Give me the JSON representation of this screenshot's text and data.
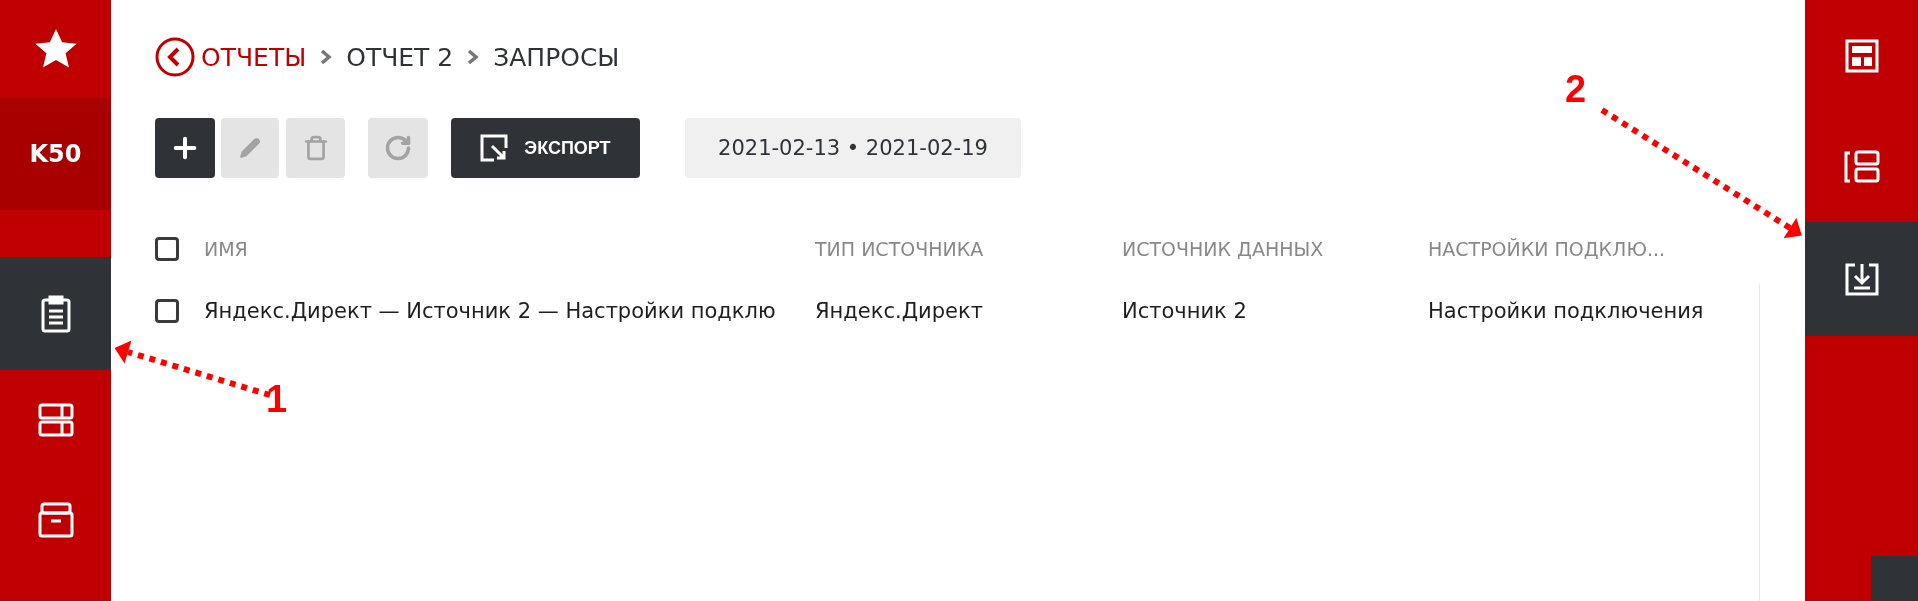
{
  "left_sidebar": {
    "items": [
      {
        "kind": "star",
        "selected": false
      },
      {
        "kind": "text",
        "label": "K50",
        "selected": false
      },
      {
        "kind": "clipboard",
        "selected": true
      },
      {
        "kind": "rows",
        "selected": false
      },
      {
        "kind": "archive",
        "selected": false
      }
    ]
  },
  "breadcrumb": {
    "items": [
      "ОТЧЕТЫ",
      "ОТЧЕТ 2",
      "ЗАПРОСЫ"
    ]
  },
  "toolbar": {
    "buttons": [
      {
        "kind": "add",
        "disabled": false
      },
      {
        "kind": "edit",
        "disabled": true
      },
      {
        "kind": "delete",
        "disabled": true
      },
      {
        "kind": "refresh",
        "disabled": true
      },
      {
        "kind": "export",
        "label": "ЭКСПОРТ",
        "disabled": false
      }
    ],
    "date_range": "2021-02-13 • 2021-02-19"
  },
  "table": {
    "columns": [
      "ИМЯ",
      "ТИП ИСТОЧНИКА",
      "ИСТОЧНИК ДАННЫХ",
      "НАСТРОЙКИ ПОДКЛЮ..."
    ],
    "header_checked": false,
    "rows": [
      {
        "checked": false,
        "cells": [
          "Яндекс.Директ — Источник 2 — Настройки подклю",
          "Яндекс.Директ",
          "Источник 2",
          "Настройки подключения"
        ]
      }
    ]
  },
  "right_sidebar": {
    "items": [
      {
        "kind": "layout",
        "selected": false
      },
      {
        "kind": "split",
        "selected": false
      },
      {
        "kind": "download",
        "selected": true
      }
    ]
  },
  "annotations": [
    {
      "label": "1",
      "kind": "left"
    },
    {
      "label": "2",
      "kind": "right"
    }
  ]
}
